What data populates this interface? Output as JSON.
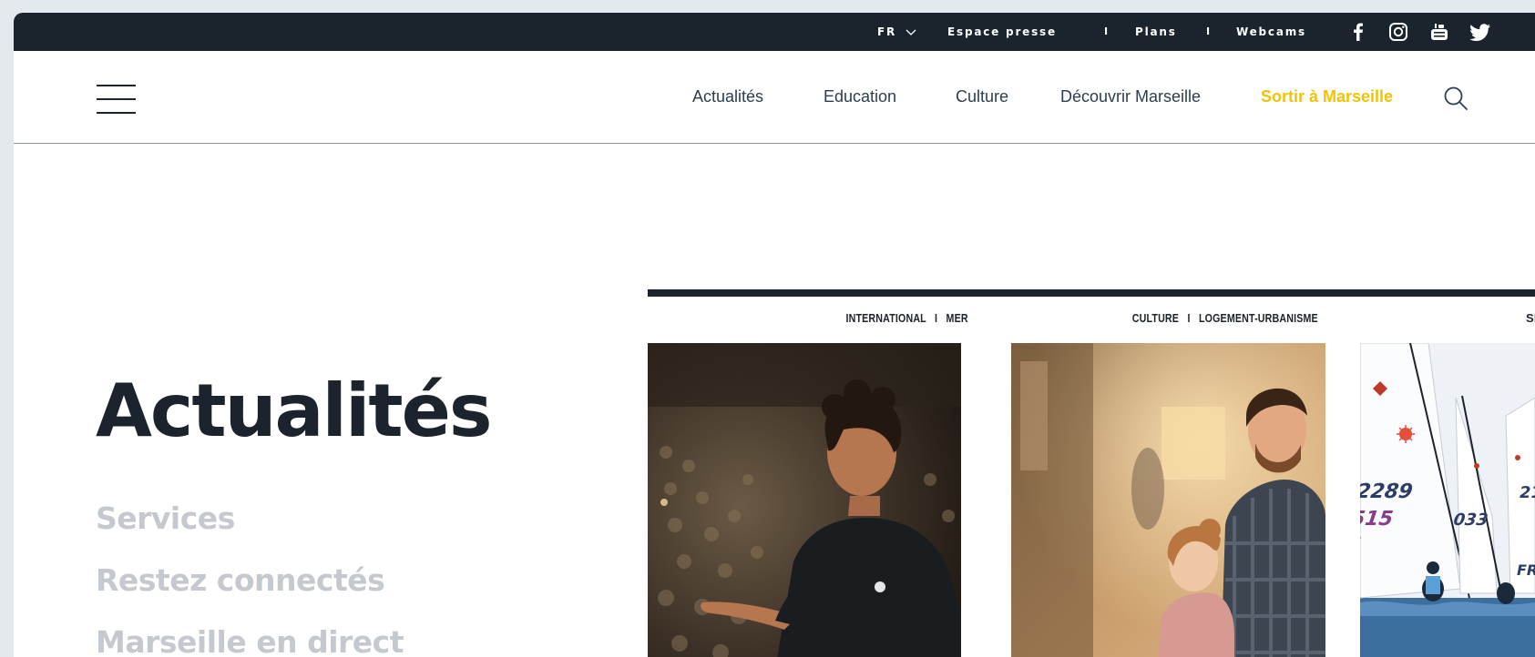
{
  "topbar": {
    "language": "FR",
    "links": [
      "Espace presse",
      "Plans",
      "Webcams"
    ],
    "separator": "I",
    "social": [
      "facebook-icon",
      "instagram-icon",
      "youtube-icon",
      "twitter-icon"
    ]
  },
  "nav": {
    "items": [
      "Actualités",
      "Education",
      "Culture",
      "Découvrir Marseille",
      "Sortir à Marseille"
    ],
    "active_index": 4,
    "active_color": "#f2c300"
  },
  "page": {
    "title": "Actualités",
    "side_links": [
      "Services",
      "Restez connectés",
      "Marseille en direct"
    ]
  },
  "cards": [
    {
      "category": "INTERNATIONAL   I   MER"
    },
    {
      "category": "CULTURE   I   LOGEMENT-URBANISME"
    },
    {
      "category": "SI"
    }
  ],
  "colors": {
    "dark": "#1b232c",
    "muted_text": "#c3c9cf",
    "accent": "#f2c300"
  }
}
